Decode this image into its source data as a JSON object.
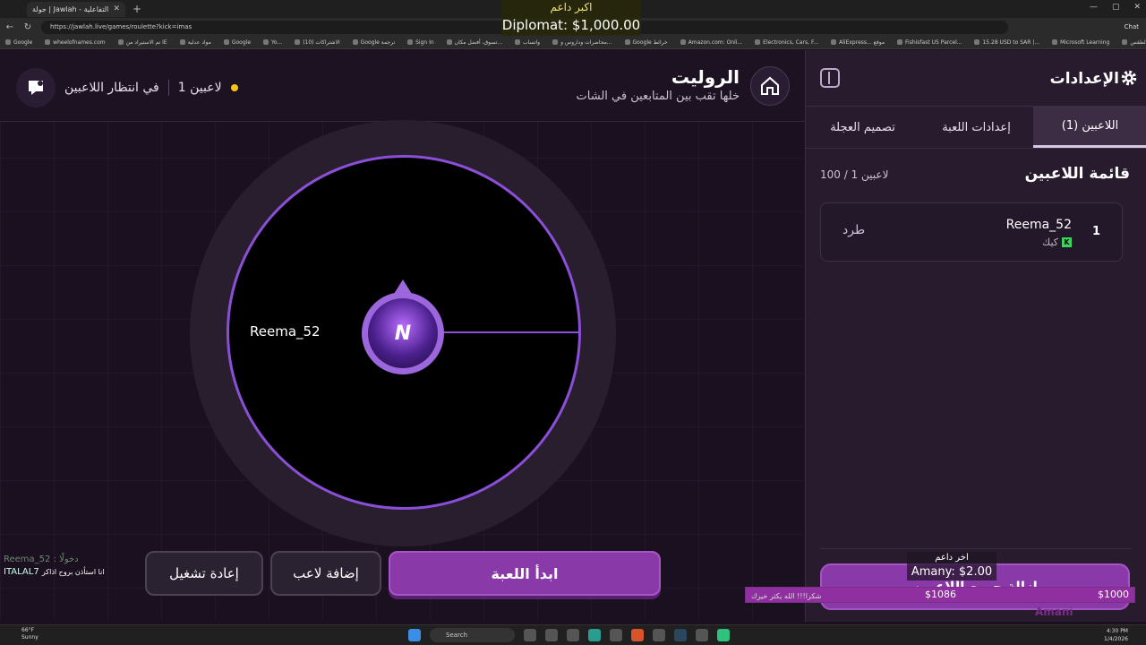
{
  "browser": {
    "tab_title": "جولة | Jawlah - منصة الألعاب التفاعلية",
    "url": "https://jawlah.live/games/roulette?kick=imas",
    "chat_label": "Chat",
    "bookmarks": [
      "Google",
      "wheelofnames.com",
      "تم الاستيراد من IE",
      "مواد عدلية",
      "Google",
      "Yo...",
      "(10) الاشتراكات",
      "Google ترجمة",
      "Sign In",
      "تسوق، أفضل مكان...",
      "واتساب",
      "محاضرات وداروس و...",
      "Google خرائط",
      "Amazon.com: Onli...",
      "Electronics, Cars, F...",
      "AliExpress... موقع",
      "Fishisfast US Parcel...",
      "15.28 USD to SAR |...",
      "Microsoft Learning",
      "الطقس"
    ]
  },
  "overlay_top": {
    "line1": "اكبر داعم",
    "line2": "Diplomat: $1,000.00"
  },
  "game": {
    "title": "الروليت",
    "subtitle": "خلها تقب بين المتابعين في الشات",
    "status_waiting": "في انتظار اللاعبين",
    "status_players": "1 لاعبين",
    "wheel_label": "Reema_52",
    "center_letter": "N",
    "start_button": "ابدأ اللعبة",
    "add_player_button": "إضافة لاعب",
    "restart_button": "إعادة تشغيل"
  },
  "chat": {
    "line1": "Reema_52 : دخولًا",
    "line2_user": "ITALAL7",
    "line2_text": "انا استأذن بروح اذاكر"
  },
  "sidebar": {
    "title": "الإعدادات",
    "tabs": [
      {
        "label": "اللاعبين (1)"
      },
      {
        "label": "إعدادات اللعبة"
      },
      {
        "label": "تصميم العجلة"
      }
    ],
    "list_title": "قائمة اللاعبين",
    "list_count": "100 / 1 لاعبين",
    "players": [
      {
        "num": "1",
        "name": "Reema_52",
        "platform": "كيك",
        "kick_label": "طرد"
      }
    ],
    "clear_button": "إزالة جميع اللاعبين"
  },
  "donation": {
    "label": "اخر داعم",
    "value": "Amany: $2.00",
    "goal_message": "شكرا!!! الله يكثر خيرك",
    "goal_current": "$1086",
    "goal_max": "$1000",
    "goal_fraction": 1.0,
    "brand": "Amani"
  },
  "taskbar": {
    "weather_temp": "66°F",
    "weather_desc": "Sunny",
    "search": "Search",
    "time": "4:30 PM",
    "date": "1/4/2026"
  }
}
